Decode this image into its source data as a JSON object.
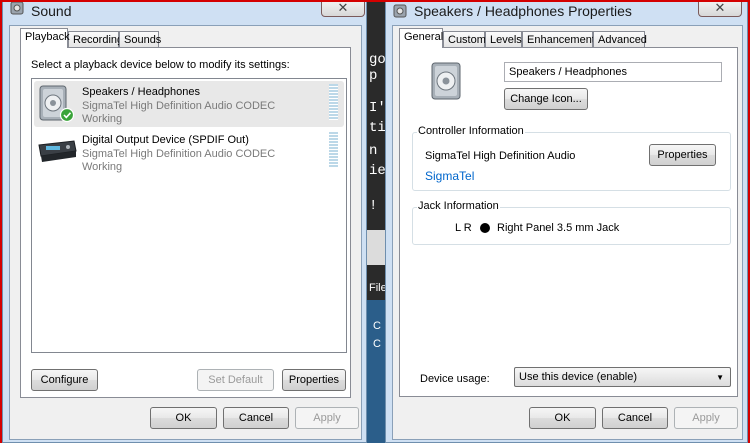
{
  "sound": {
    "title": "Sound",
    "tabs": [
      "Playback",
      "Recording",
      "Sounds"
    ],
    "instruction": "Select a playback device below to modify its settings:",
    "devices": [
      {
        "name": "Speakers / Headphones",
        "description": "SigmaTel High Definition Audio CODEC",
        "status": "Working"
      },
      {
        "name": "Digital Output Device (SPDIF Out)",
        "description": "SigmaTel High Definition Audio CODEC",
        "status": "Working"
      }
    ],
    "configure_label": "Configure",
    "set_default_label": "Set Default",
    "properties_label": "Properties",
    "ok_label": "OK",
    "cancel_label": "Cancel",
    "apply_label": "Apply"
  },
  "props": {
    "title": "Speakers / Headphones Properties",
    "tabs": [
      "General",
      "Custom",
      "Levels",
      "Enhancements",
      "Advanced"
    ],
    "device_name": "Speakers / Headphones",
    "change_icon_label": "Change Icon...",
    "controller": {
      "group_label": "Controller Information",
      "name": "SigmaTel High Definition Audio",
      "properties_label": "Properties",
      "vendor_link": "SigmaTel"
    },
    "jack": {
      "group_label": "Jack Information",
      "channels": "L R",
      "description": "Right Panel 3.5 mm Jack"
    },
    "usage_label": "Device usage:",
    "usage_value": "Use this device (enable)",
    "ok_label": "OK",
    "cancel_label": "Cancel",
    "apply_label": "Apply"
  },
  "background": {
    "text_lines": [
      "go",
      "p",
      "I'",
      "ti",
      "n",
      "ie",
      "",
      "!",
      "",
      "File",
      "C",
      "C"
    ]
  },
  "icons": {
    "speaker": "speaker-icon",
    "digital_output": "digital-output-device-icon",
    "working_check": "check-badge-icon",
    "jack_dot": "jack-connected-dot",
    "dropdown": "chevron-down-icon"
  },
  "colors": {
    "accent_border": "#d40000",
    "link": "#0066cc",
    "level_meter": "#bcd8e8"
  }
}
